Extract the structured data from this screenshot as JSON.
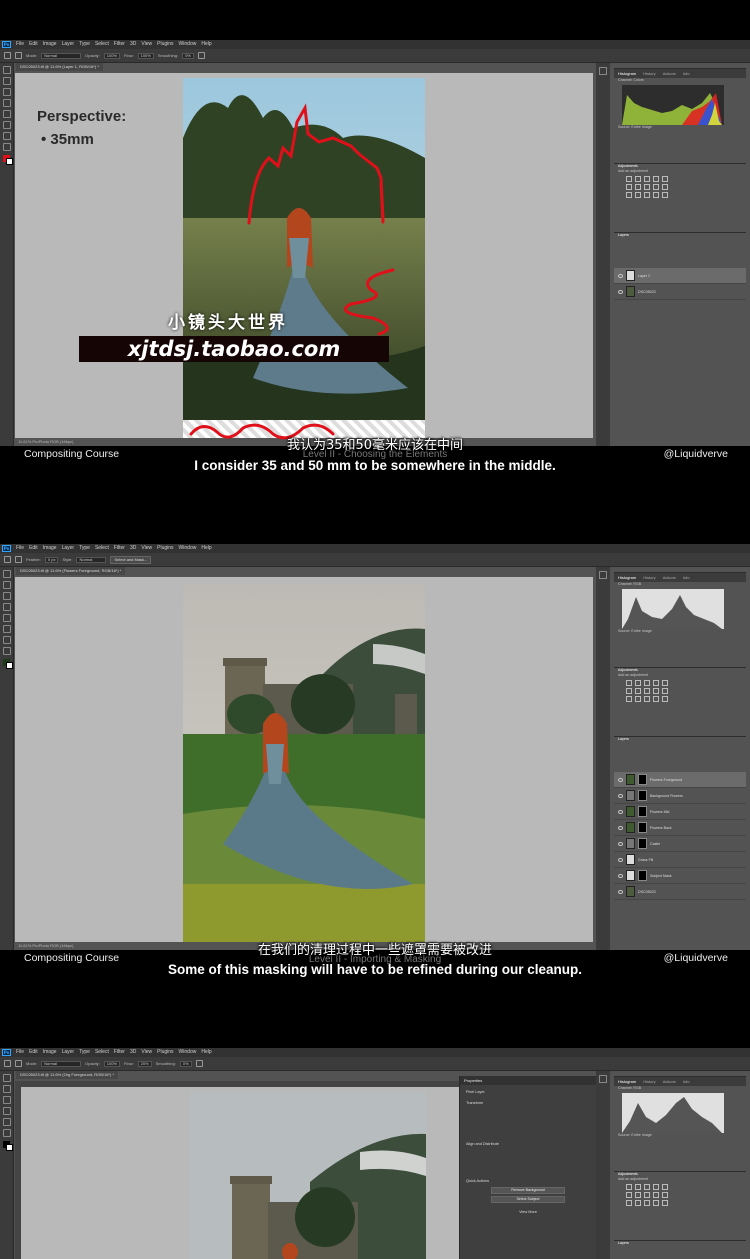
{
  "menu": {
    "logo": "Ps",
    "items": [
      "File",
      "Edit",
      "Image",
      "Layer",
      "Type",
      "Select",
      "Filter",
      "3D",
      "View",
      "Plugins",
      "Window",
      "Help"
    ]
  },
  "frames": [
    {
      "doc_tab": "DSC05023.tif @ 11.6% (Layer 1, RGB/16*) *",
      "options": {
        "mode_label": "Mode:",
        "mode": "Normal",
        "opacity_label": "Opacity:",
        "opacity": "100%",
        "flow_label": "Flow:",
        "flow": "100%",
        "smoothing_label": "Smoothing:",
        "smoothing": "0%"
      },
      "status": "11.61%   ProPhoto RGB (16bpc)",
      "perspective_title": "Perspective:",
      "perspective_item": "35mm",
      "watermark_cn": "小镜头大世界",
      "watermark_url": "xjtdsj.taobao.com",
      "histogram": {
        "tabs": [
          "Histogram",
          "History",
          "Actions",
          "Info"
        ],
        "channel_label": "Channel:",
        "channel": "Colors",
        "source_label": "Source:",
        "source": "Entire Image"
      },
      "adjustments_title": "Adjustments",
      "adjustments_add": "Add an adjustment",
      "layers_title": "Layers",
      "layers": [
        "Layer 1",
        "DSC05023"
      ],
      "level_text": "Level II - Choosing the Elements",
      "subtitle_cn": "我认为35和50毫米应该在中间",
      "subtitle_en": "I consider 35 and 50 mm to be somewhere in the middle.",
      "course": "Compositing Course",
      "handle": "@Liquidverve"
    },
    {
      "doc_tab": "DSC05023.tif @ 11.6% (Flowers Foreground, RGB/16*) *",
      "options": {
        "feather_label": "Feather:",
        "feather": "0 px",
        "style_label": "Style:",
        "style": "Normal",
        "select_mask": "Select and Mask..."
      },
      "status": "11.61%   ProPhoto RGB (16bpc)",
      "histogram": {
        "tabs": [
          "Histogram",
          "History",
          "Actions",
          "Info"
        ],
        "channel_label": "Channel:",
        "channel": "RGB",
        "source_label": "Source:",
        "source": "Entire Image"
      },
      "adjustments_title": "Adjustments",
      "adjustments_add": "Add an adjustment",
      "layers_title": "Layers",
      "layers": [
        "Flowers Foreground",
        "Background Flowers",
        "Flowers Mid",
        "Flowers Back",
        "Castle",
        "Grass Fill",
        "Subject Mask",
        "DSC05023"
      ],
      "level_text": "Level II - Importing & Masking",
      "subtitle_cn": "在我们的清理过程中一些遮罩需要被改进",
      "subtitle_en": "Some of this masking will have to be refined during our cleanup.",
      "course": "Compositing Course",
      "handle": "@Liquidverve"
    },
    {
      "doc_tab": "DSC05023.tif @ 11.6% (Org Foreground, RGB/16*) *",
      "options": {
        "mode_label": "Mode:",
        "mode": "Normal",
        "opacity_label": "Opacity:",
        "opacity": "100%",
        "flow_label": "Flow:",
        "flow": "20%",
        "smoothing_label": "Smoothing:",
        "smoothing": "0%"
      },
      "properties": {
        "title": "Properties",
        "layer": "Pixel Layer",
        "transform": "Transform",
        "align": "Align and Distribute",
        "quick_actions": "Quick Actions",
        "remove_bg": "Remove Background",
        "select_subject": "Select Subject",
        "more": "View More"
      },
      "histogram": {
        "tabs": [
          "Histogram",
          "History",
          "Actions",
          "Info"
        ],
        "channel_label": "Channel:",
        "channel": "RGB",
        "source_label": "Source:",
        "source": "Entire Image"
      },
      "adjustments_title": "Adjustments",
      "adjustments_add": "Add an adjustment",
      "layers_title": "Layers"
    }
  ],
  "colors": {
    "ps_bg": "#535353",
    "canvas": "#b9b9b9",
    "accent_red": "#e0101a"
  }
}
